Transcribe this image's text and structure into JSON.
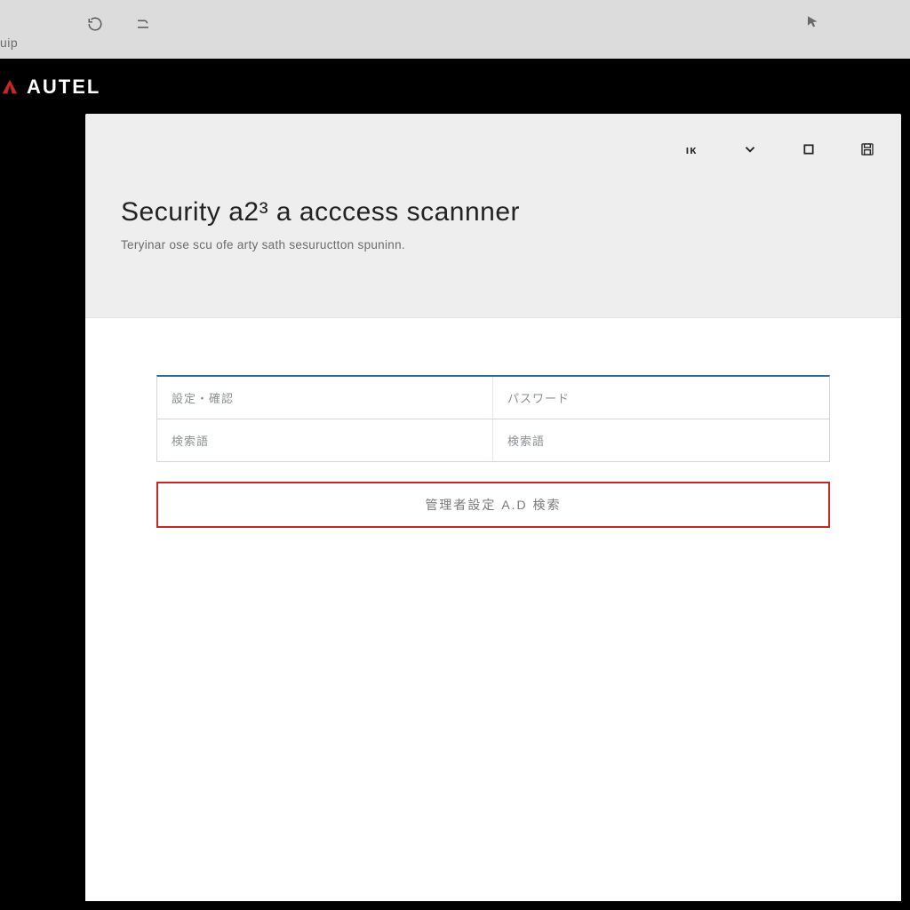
{
  "chrome": {
    "url_fragment": "uip"
  },
  "brand": {
    "name": "AUTEL"
  },
  "header": {
    "title": "Security a2³ a acccess scannner",
    "subtitle": "Teryinar ose scu ofe arty sath sesuructton spuninn."
  },
  "toolbar": {
    "action1_symbol": "ıκ"
  },
  "form": {
    "field1_label": "設定・確認",
    "field2_label": "パスワード",
    "field3_label": "検索語",
    "field4_label": "検索語",
    "submit_label": "管理者設定 A.D 検索"
  }
}
